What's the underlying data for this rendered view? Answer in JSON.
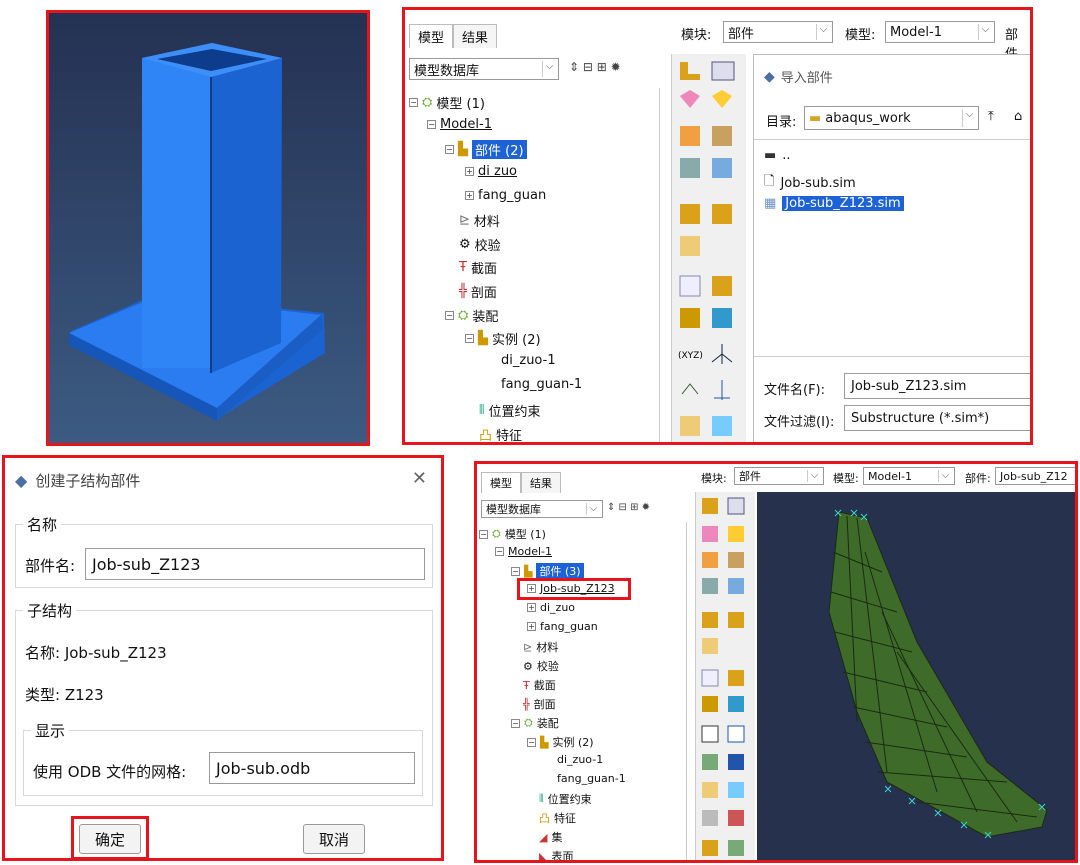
{
  "panel_import": {
    "tabs": [
      "模型",
      "结果"
    ],
    "module_label": "模块:",
    "module_value": "部件",
    "model_label": "模型:",
    "model_value": "Model-1",
    "part_label_cut": "部件",
    "db_label": "模型数据库",
    "tree": [
      {
        "text": "模型 (1)",
        "level": 0
      },
      {
        "text": "Model-1",
        "level": 1
      },
      {
        "text": "部件 (2)",
        "level": 2
      },
      {
        "text": "di zuo",
        "level": 3
      },
      {
        "text": "fang_guan",
        "level": 3
      },
      {
        "text": "材料",
        "level": 2
      },
      {
        "text": "校验",
        "level": 2
      },
      {
        "text": "截面",
        "level": 2
      },
      {
        "text": "剖面",
        "level": 2
      },
      {
        "text": "装配",
        "level": 2
      },
      {
        "text": "实例 (2)",
        "level": 3
      },
      {
        "text": "di_zuo-1",
        "level": 4
      },
      {
        "text": "fang_guan-1",
        "level": 4
      },
      {
        "text": "位置约束",
        "level": 3
      },
      {
        "text": "特征",
        "level": 3
      }
    ],
    "dialog": {
      "title": "导入部件",
      "dir_label": "目录:",
      "dir_value": "abaqus_work",
      "files": [
        "..",
        "Job-sub.sim",
        "Job-sub_Z123.sim"
      ],
      "filename_label": "文件名(F):",
      "filename_value": "Job-sub_Z123.sim",
      "filter_label": "文件过滤(I):",
      "filter_value": "Substructure (*.sim*)"
    }
  },
  "panel_dialog": {
    "title": "创建子结构部件",
    "close": "✕",
    "name_group": "名称",
    "part_name_label": "部件名:",
    "part_name_value": "Job-sub_Z123",
    "sub_group": "子结构",
    "name_line": "名称:  Job-sub_Z123",
    "type_line": "类型:  Z123",
    "display_group": "显示",
    "odb_label": "使用 ODB 文件的网格:",
    "odb_value": "Job-sub.odb",
    "ok": "确定",
    "cancel": "取消"
  },
  "panel_mesh": {
    "tabs": [
      "模型",
      "结果"
    ],
    "module_label": "模块:",
    "module_value": "部件",
    "model_label": "模型:",
    "model_value": "Model-1",
    "part_label": "部件:",
    "part_value": "Job-sub_Z12",
    "db_label": "模型数据库",
    "tree": [
      {
        "text": "模型 (1)"
      },
      {
        "text": "Model-1"
      },
      {
        "text": "部件 (3)"
      },
      {
        "text": "Job-sub_Z123"
      },
      {
        "text": "di_zuo"
      },
      {
        "text": "fang_guan"
      },
      {
        "text": "材料"
      },
      {
        "text": "校验"
      },
      {
        "text": "截面"
      },
      {
        "text": "剖面"
      },
      {
        "text": "装配"
      },
      {
        "text": "实例 (2)"
      },
      {
        "text": "di_zuo-1"
      },
      {
        "text": "fang_guan-1"
      },
      {
        "text": "位置约束"
      },
      {
        "text": "特征"
      },
      {
        "text": "集"
      },
      {
        "text": "表面"
      }
    ]
  },
  "colors": {
    "highlight": "#e8141c",
    "selection": "#1d62d6",
    "part_blue": "#1f6fdc",
    "mesh_green": "#3f6b2a",
    "viewport": "#26324d"
  }
}
